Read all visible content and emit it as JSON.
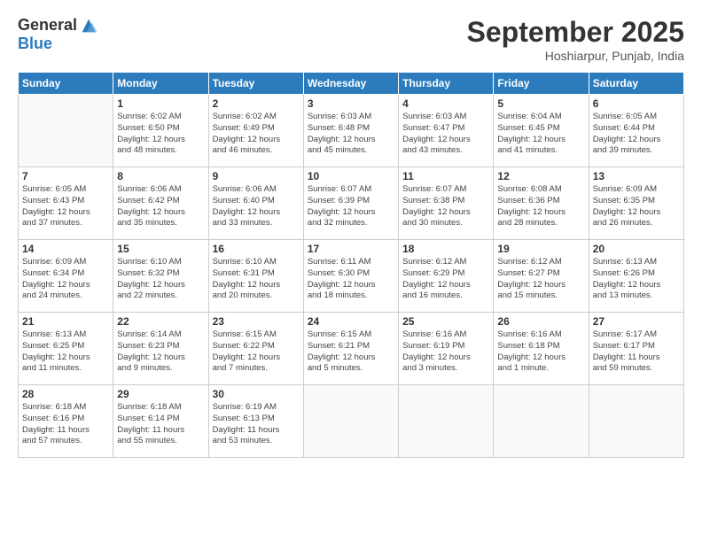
{
  "logo": {
    "general": "General",
    "blue": "Blue"
  },
  "title": {
    "month": "September 2025",
    "location": "Hoshiarpur, Punjab, India"
  },
  "weekdays": [
    "Sunday",
    "Monday",
    "Tuesday",
    "Wednesday",
    "Thursday",
    "Friday",
    "Saturday"
  ],
  "weeks": [
    [
      {
        "day": "",
        "info": ""
      },
      {
        "day": "1",
        "info": "Sunrise: 6:02 AM\nSunset: 6:50 PM\nDaylight: 12 hours\nand 48 minutes."
      },
      {
        "day": "2",
        "info": "Sunrise: 6:02 AM\nSunset: 6:49 PM\nDaylight: 12 hours\nand 46 minutes."
      },
      {
        "day": "3",
        "info": "Sunrise: 6:03 AM\nSunset: 6:48 PM\nDaylight: 12 hours\nand 45 minutes."
      },
      {
        "day": "4",
        "info": "Sunrise: 6:03 AM\nSunset: 6:47 PM\nDaylight: 12 hours\nand 43 minutes."
      },
      {
        "day": "5",
        "info": "Sunrise: 6:04 AM\nSunset: 6:45 PM\nDaylight: 12 hours\nand 41 minutes."
      },
      {
        "day": "6",
        "info": "Sunrise: 6:05 AM\nSunset: 6:44 PM\nDaylight: 12 hours\nand 39 minutes."
      }
    ],
    [
      {
        "day": "7",
        "info": "Sunrise: 6:05 AM\nSunset: 6:43 PM\nDaylight: 12 hours\nand 37 minutes."
      },
      {
        "day": "8",
        "info": "Sunrise: 6:06 AM\nSunset: 6:42 PM\nDaylight: 12 hours\nand 35 minutes."
      },
      {
        "day": "9",
        "info": "Sunrise: 6:06 AM\nSunset: 6:40 PM\nDaylight: 12 hours\nand 33 minutes."
      },
      {
        "day": "10",
        "info": "Sunrise: 6:07 AM\nSunset: 6:39 PM\nDaylight: 12 hours\nand 32 minutes."
      },
      {
        "day": "11",
        "info": "Sunrise: 6:07 AM\nSunset: 6:38 PM\nDaylight: 12 hours\nand 30 minutes."
      },
      {
        "day": "12",
        "info": "Sunrise: 6:08 AM\nSunset: 6:36 PM\nDaylight: 12 hours\nand 28 minutes."
      },
      {
        "day": "13",
        "info": "Sunrise: 6:09 AM\nSunset: 6:35 PM\nDaylight: 12 hours\nand 26 minutes."
      }
    ],
    [
      {
        "day": "14",
        "info": "Sunrise: 6:09 AM\nSunset: 6:34 PM\nDaylight: 12 hours\nand 24 minutes."
      },
      {
        "day": "15",
        "info": "Sunrise: 6:10 AM\nSunset: 6:32 PM\nDaylight: 12 hours\nand 22 minutes."
      },
      {
        "day": "16",
        "info": "Sunrise: 6:10 AM\nSunset: 6:31 PM\nDaylight: 12 hours\nand 20 minutes."
      },
      {
        "day": "17",
        "info": "Sunrise: 6:11 AM\nSunset: 6:30 PM\nDaylight: 12 hours\nand 18 minutes."
      },
      {
        "day": "18",
        "info": "Sunrise: 6:12 AM\nSunset: 6:29 PM\nDaylight: 12 hours\nand 16 minutes."
      },
      {
        "day": "19",
        "info": "Sunrise: 6:12 AM\nSunset: 6:27 PM\nDaylight: 12 hours\nand 15 minutes."
      },
      {
        "day": "20",
        "info": "Sunrise: 6:13 AM\nSunset: 6:26 PM\nDaylight: 12 hours\nand 13 minutes."
      }
    ],
    [
      {
        "day": "21",
        "info": "Sunrise: 6:13 AM\nSunset: 6:25 PM\nDaylight: 12 hours\nand 11 minutes."
      },
      {
        "day": "22",
        "info": "Sunrise: 6:14 AM\nSunset: 6:23 PM\nDaylight: 12 hours\nand 9 minutes."
      },
      {
        "day": "23",
        "info": "Sunrise: 6:15 AM\nSunset: 6:22 PM\nDaylight: 12 hours\nand 7 minutes."
      },
      {
        "day": "24",
        "info": "Sunrise: 6:15 AM\nSunset: 6:21 PM\nDaylight: 12 hours\nand 5 minutes."
      },
      {
        "day": "25",
        "info": "Sunrise: 6:16 AM\nSunset: 6:19 PM\nDaylight: 12 hours\nand 3 minutes."
      },
      {
        "day": "26",
        "info": "Sunrise: 6:16 AM\nSunset: 6:18 PM\nDaylight: 12 hours\nand 1 minute."
      },
      {
        "day": "27",
        "info": "Sunrise: 6:17 AM\nSunset: 6:17 PM\nDaylight: 11 hours\nand 59 minutes."
      }
    ],
    [
      {
        "day": "28",
        "info": "Sunrise: 6:18 AM\nSunset: 6:16 PM\nDaylight: 11 hours\nand 57 minutes."
      },
      {
        "day": "29",
        "info": "Sunrise: 6:18 AM\nSunset: 6:14 PM\nDaylight: 11 hours\nand 55 minutes."
      },
      {
        "day": "30",
        "info": "Sunrise: 6:19 AM\nSunset: 6:13 PM\nDaylight: 11 hours\nand 53 minutes."
      },
      {
        "day": "",
        "info": ""
      },
      {
        "day": "",
        "info": ""
      },
      {
        "day": "",
        "info": ""
      },
      {
        "day": "",
        "info": ""
      }
    ]
  ]
}
